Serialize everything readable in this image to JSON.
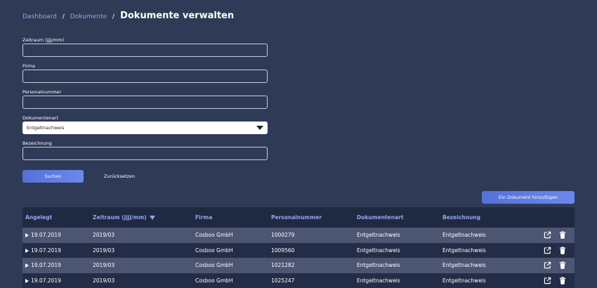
{
  "breadcrumb": {
    "items": [
      "Dashboard",
      "Dokumente"
    ],
    "separator": "/",
    "title": "Dokumente verwalten"
  },
  "form": {
    "fields": [
      {
        "label": "Zeitraum (jjjj/mm)",
        "value": ""
      },
      {
        "label": "Firma",
        "value": ""
      },
      {
        "label": "Personalnummer",
        "value": ""
      }
    ],
    "document_type": {
      "label": "Dokumentenart",
      "selected": "Entgeltnachweis"
    },
    "designation": {
      "label": "Bezeichnung",
      "value": ""
    }
  },
  "buttons": {
    "search": "Suchen",
    "reset": "Zurücksetzen",
    "add_document": "Ein Dokument hinzufügen"
  },
  "table": {
    "headers": [
      "Angelegt",
      "Zeitraum (jjjj/mm)",
      "Firma",
      "Personalnummer",
      "Dokumentenart",
      "Bezeichnung"
    ],
    "rows": [
      {
        "created": "19.07.2019",
        "period": "2019/03",
        "company": "Cosboo GmbH",
        "personnel_no": "1000279",
        "doc_type": "Entgeltnachweis",
        "designation": "Entgeltnachweis"
      },
      {
        "created": "19.07.2019",
        "period": "2019/03",
        "company": "Cosboo GmbH",
        "personnel_no": "1009560",
        "doc_type": "Entgeltnachweis",
        "designation": "Entgeltnachweis"
      },
      {
        "created": "19.07.2019",
        "period": "2019/03",
        "company": "Cosboo GmbH",
        "personnel_no": "1021282",
        "doc_type": "Entgeltnachweis",
        "designation": "Entgeltnachweis"
      },
      {
        "created": "19.07.2019",
        "period": "2019/03",
        "company": "Cosboo GmbH",
        "personnel_no": "1025247",
        "doc_type": "Entgeltnachweis",
        "designation": "Entgeltnachweis"
      }
    ],
    "row_icons": [
      "external-link-icon",
      "trash-icon"
    ]
  },
  "colors": {
    "background": "#2e3a56",
    "accent": "#8fa7f0",
    "primary_button": "#5a74dd",
    "row_light": "#4c5673",
    "row_dark": "#232d47"
  }
}
